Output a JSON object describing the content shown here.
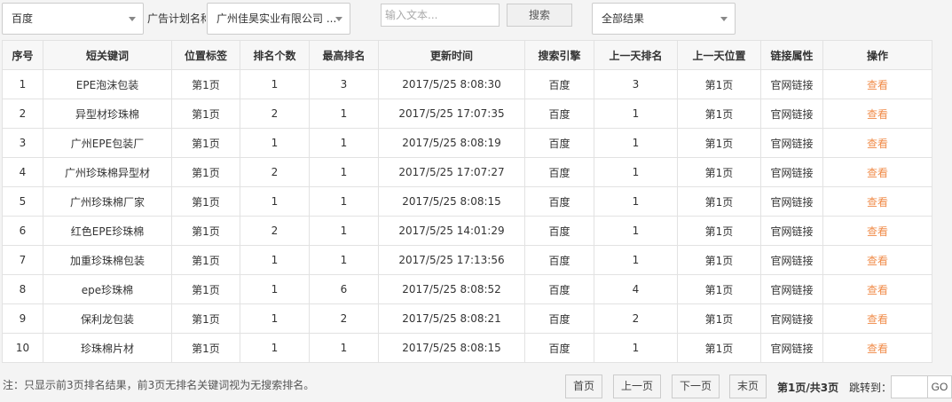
{
  "filters": {
    "engine_select": "百度",
    "plan_label": "广告计划名称",
    "plan_select": "广州佳昊实业有限公司 ...",
    "keyword_placeholder": "输入文本...",
    "search_button": "搜索",
    "result_select": "全部结果"
  },
  "table": {
    "headers": [
      "序号",
      "短关键词",
      "位置标签",
      "排名个数",
      "最高排名",
      "更新时间",
      "搜索引擎",
      "上一天排名",
      "上一天位置",
      "链接属性",
      "操作"
    ],
    "rows": [
      [
        "1",
        "EPE泡沫包装",
        "第1页",
        "1",
        "3",
        "2017/5/25 8:08:30",
        "百度",
        "3",
        "第1页",
        "官网链接",
        "查看"
      ],
      [
        "2",
        "异型材珍珠棉",
        "第1页",
        "2",
        "1",
        "2017/5/25 17:07:35",
        "百度",
        "1",
        "第1页",
        "官网链接",
        "查看"
      ],
      [
        "3",
        "广州EPE包装厂",
        "第1页",
        "1",
        "1",
        "2017/5/25 8:08:19",
        "百度",
        "1",
        "第1页",
        "官网链接",
        "查看"
      ],
      [
        "4",
        "广州珍珠棉异型材",
        "第1页",
        "2",
        "1",
        "2017/5/25 17:07:27",
        "百度",
        "1",
        "第1页",
        "官网链接",
        "查看"
      ],
      [
        "5",
        "广州珍珠棉厂家",
        "第1页",
        "1",
        "1",
        "2017/5/25 8:08:15",
        "百度",
        "1",
        "第1页",
        "官网链接",
        "查看"
      ],
      [
        "6",
        "红色EPE珍珠棉",
        "第1页",
        "2",
        "1",
        "2017/5/25 14:01:29",
        "百度",
        "1",
        "第1页",
        "官网链接",
        "查看"
      ],
      [
        "7",
        "加重珍珠棉包装",
        "第1页",
        "1",
        "1",
        "2017/5/25 17:13:56",
        "百度",
        "1",
        "第1页",
        "官网链接",
        "查看"
      ],
      [
        "8",
        "epe珍珠棉",
        "第1页",
        "1",
        "6",
        "2017/5/25 8:08:52",
        "百度",
        "4",
        "第1页",
        "官网链接",
        "查看"
      ],
      [
        "9",
        "保利龙包装",
        "第1页",
        "1",
        "2",
        "2017/5/25 8:08:21",
        "百度",
        "2",
        "第1页",
        "官网链接",
        "查看"
      ],
      [
        "10",
        "珍珠棉片材",
        "第1页",
        "1",
        "1",
        "2017/5/25 8:08:15",
        "百度",
        "1",
        "第1页",
        "官网链接",
        "查看"
      ]
    ]
  },
  "footer": {
    "note": "注：只显示前3页排名结果，前3页无排名关键词视为无搜索排名。",
    "first": "首页",
    "prev": "上一页",
    "next": "下一页",
    "last": "末页",
    "page_info": "第1页/共3页",
    "jump_label": "跳转到：",
    "go": "GO"
  }
}
